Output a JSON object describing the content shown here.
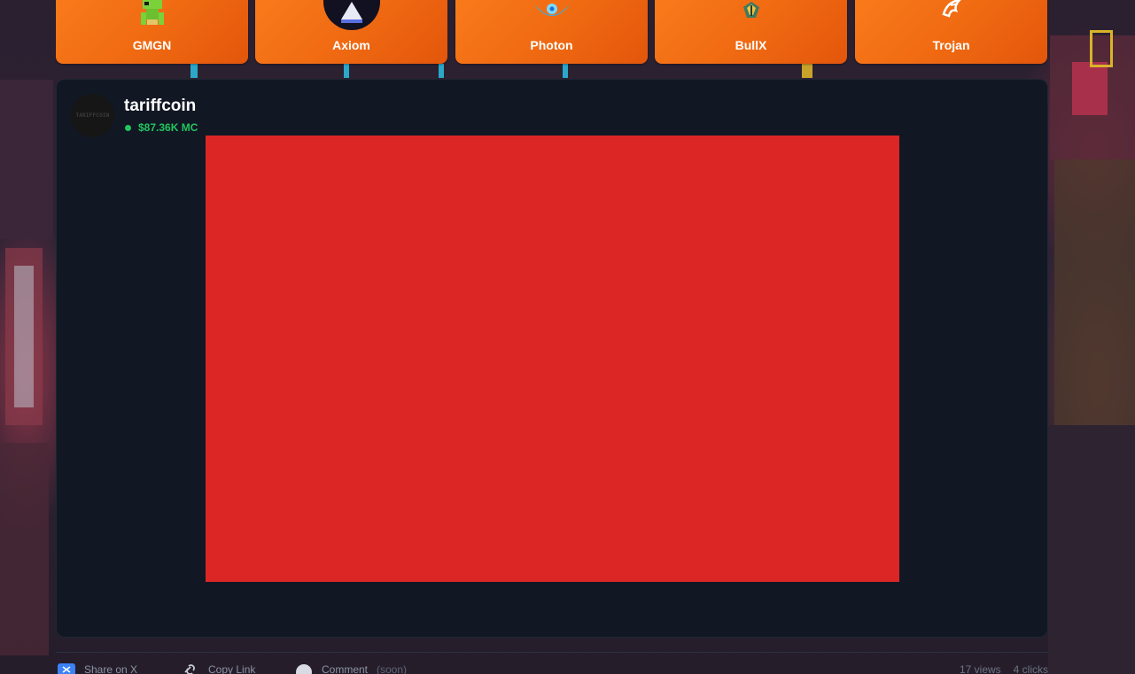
{
  "launchers": [
    {
      "label": "GMGN",
      "icon": "frog-icon"
    },
    {
      "label": "Axiom",
      "icon": "axiom-triangle-icon"
    },
    {
      "label": "Photon",
      "icon": "photon-gear-icon"
    },
    {
      "label": "BullX",
      "icon": "bullx-bull-icon"
    },
    {
      "label": "Trojan",
      "icon": "trojan-helmet-icon"
    }
  ],
  "post": {
    "coin_name": "tariffcoin",
    "market_cap": "$87.36K MC",
    "avatar_text": "TARIFFCOIN",
    "media_color": "#dc2626"
  },
  "actions": {
    "share_label": "Share on X",
    "copy_label": "Copy Link",
    "comment_label": "Comment",
    "comment_hint": "(soon)",
    "views": "17 views",
    "clicks": "4 clicks"
  },
  "colors": {
    "accent_orange": "#f06a12",
    "card_bg": "#111723",
    "market_green": "#22c55e"
  }
}
